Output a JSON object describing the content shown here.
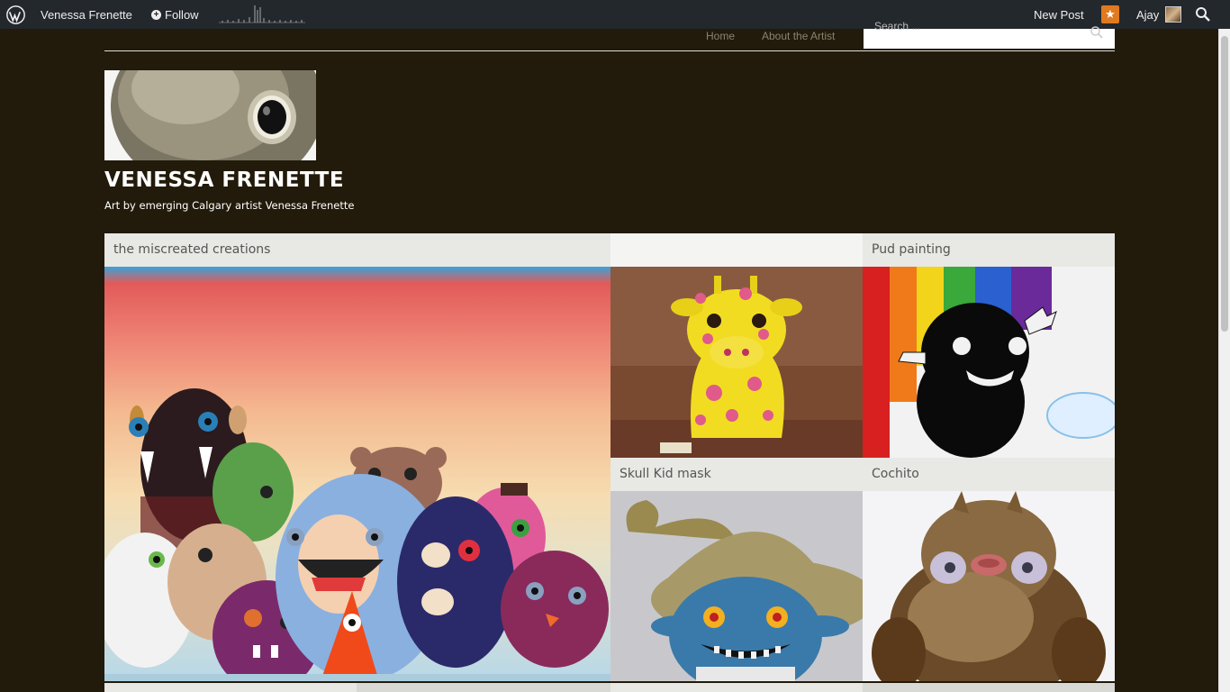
{
  "adminbar": {
    "site_name": "Venessa Frenette",
    "follow_label": "Follow",
    "new_post_label": "New Post",
    "user_name": "Ajay"
  },
  "nav": {
    "home": "Home",
    "about": "About the Artist",
    "search_placeholder": "Search ..."
  },
  "site": {
    "title": "VENESSA FRENETTE",
    "description": "Art by emerging Calgary artist Venessa Frenette"
  },
  "posts": [
    {
      "title": "the miscreated creations"
    },
    {
      "title": ""
    },
    {
      "title": "Pud painting"
    },
    {
      "title": "Skull Kid mask"
    },
    {
      "title": "Cochito"
    }
  ],
  "colors": {
    "background": "#221a0a",
    "adminbar": "#23282d",
    "notification": "#e07a1f",
    "caption_bg": "#e8e8e5"
  }
}
